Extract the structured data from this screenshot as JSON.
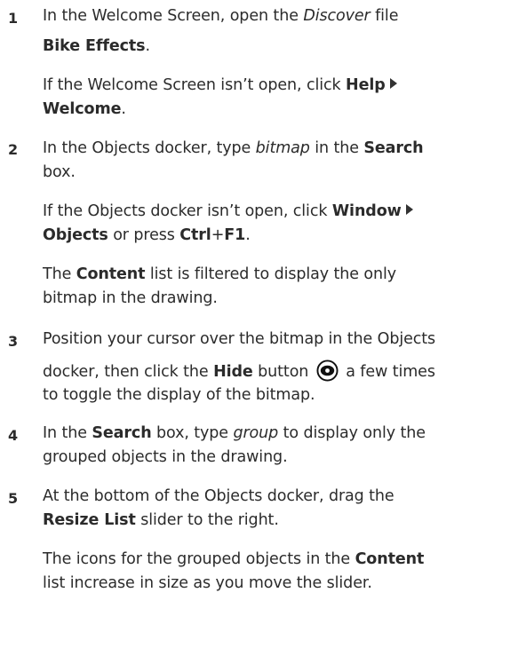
{
  "steps": [
    {
      "number": "1",
      "lines": [
        {
          "t1": "In the Welcome Screen, open the ",
          "t2": "Discover",
          "t3": " file"
        },
        {
          "b1": "Bike Effects",
          "t1": "."
        }
      ],
      "note": {
        "t1": "If the Welcome Screen isn’t open, click ",
        "b1": "Help",
        "b2": "Welcome",
        "t2": "."
      }
    },
    {
      "number": "2",
      "lines": [
        {
          "t1": "In the Objects docker, type ",
          "i1": "bitmap",
          "t2": " in the ",
          "b1": "Search"
        },
        {
          "t1": "box."
        }
      ],
      "note1": {
        "t1": "If the Objects docker isn’t open, click ",
        "b1": "Window",
        "b2": "Objects",
        "t2": " or press ",
        "b3": "Ctrl",
        "t3": "+",
        "b4": "F1",
        "t4": "."
      },
      "note2": {
        "t1": "The ",
        "b1": "Content",
        "t2": " list is filtered to display the only",
        "t3": "bitmap in the drawing."
      }
    },
    {
      "number": "3",
      "lines": [
        {
          "t1": "Position your cursor over the bitmap in the Objects"
        },
        {
          "t1": "docker, then click the ",
          "b1": "Hide",
          "t2": " button ",
          "t3": " a few times"
        },
        {
          "t1": "to toggle the display of the bitmap."
        }
      ]
    },
    {
      "number": "4",
      "lines": [
        {
          "t1": "In the ",
          "b1": "Search",
          "t2": " box, type ",
          "i1": "group",
          "t3": " to display only the"
        },
        {
          "t1": "grouped objects in the drawing."
        }
      ]
    },
    {
      "number": "5",
      "lines": [
        {
          "t1": "At the bottom of the Objects docker, drag the"
        },
        {
          "b1": "Resize List",
          "t1": " slider to the right."
        }
      ],
      "note": {
        "t1": "The icons for the grouped objects in the ",
        "b1": "Content",
        "t2": "list increase in size as you move the slider."
      }
    }
  ],
  "icons": {
    "submenu_arrow": "submenu-arrow-icon",
    "hide_button": "eye-icon"
  },
  "colors": {
    "text": "#2b2b2b"
  }
}
